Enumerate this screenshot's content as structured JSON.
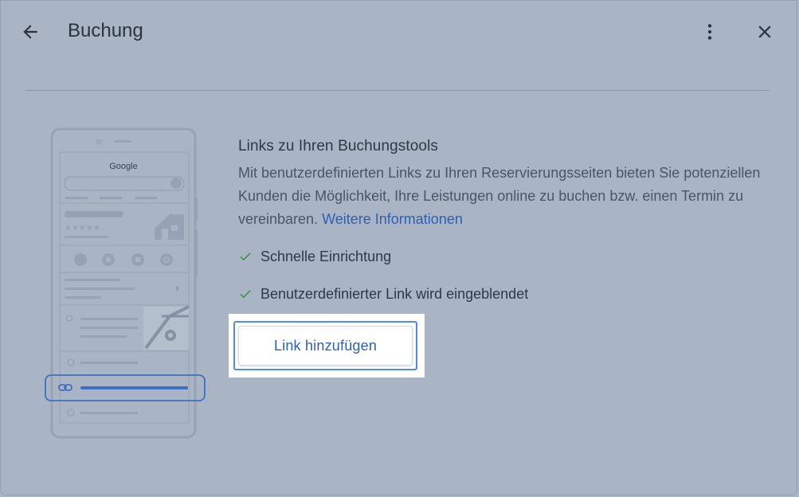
{
  "header": {
    "title": "Buchung",
    "back_icon": "arrow-left-icon",
    "more_icon": "more-vert-icon",
    "close_icon": "close-icon"
  },
  "illustration": {
    "search_brand": "Google",
    "rating_stars": "★★★★★",
    "chevron": "›"
  },
  "main": {
    "heading": "Links zu Ihren Buchungstools",
    "description": "Mit benutzerdefinierten Links zu Ihren Reservierungsseiten bieten Sie potenziellen Kunden die Möglichkeit, Ihre Leistungen online zu buchen bzw. einen Termin zu vereinbaren.",
    "more_info_link": "Weitere Informationen",
    "features": [
      {
        "label": "Schnelle Einrichtung"
      },
      {
        "label": "Benutzerdefinierter Link wird eingeblendet"
      }
    ],
    "add_link_button": "Link hinzufügen"
  },
  "colors": {
    "background": "#a9b5c5",
    "accent_link": "#2f5fb0",
    "check": "#3f8a4a",
    "button_focus": "#4f8de8"
  }
}
